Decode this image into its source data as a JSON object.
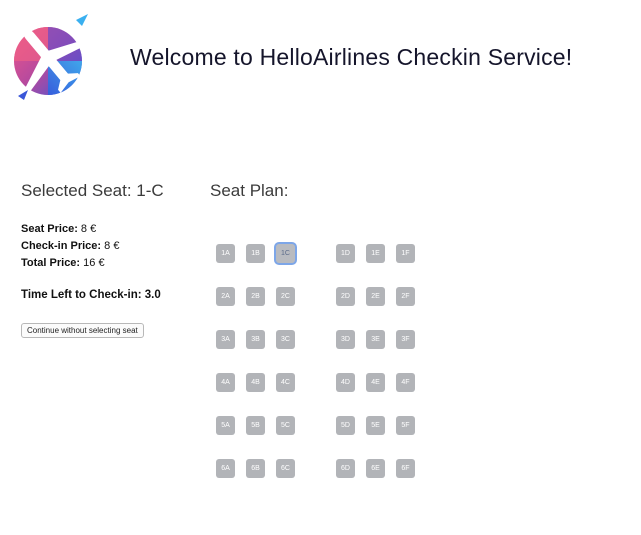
{
  "header": {
    "welcome_text": "Welcome to HelloAirlines Checkin Service!"
  },
  "selection": {
    "selected_seat_label": "Selected Seat: 1-C",
    "seat_price_label": "Seat Price:",
    "seat_price_value": " 8 €",
    "checkin_price_label": "Check-in Price:",
    "checkin_price_value": " 8 €",
    "total_price_label": "Total Price:",
    "total_price_value": " 16 €",
    "time_left_text": "Time Left to Check-in: 3.0",
    "continue_button_label": "Continue without selecting seat"
  },
  "seat_plan": {
    "title": "Seat Plan:",
    "selected_seat": "1C",
    "rows": [
      [
        "1A",
        "1B",
        "1C",
        "1D",
        "1E",
        "1F"
      ],
      [
        "2A",
        "2B",
        "2C",
        "2D",
        "2E",
        "2F"
      ],
      [
        "3A",
        "3B",
        "3C",
        "3D",
        "3E",
        "3F"
      ],
      [
        "4A",
        "4B",
        "4C",
        "4D",
        "4E",
        "4F"
      ],
      [
        "5A",
        "5B",
        "5C",
        "5D",
        "5E",
        "5F"
      ],
      [
        "6A",
        "6B",
        "6C",
        "6D",
        "6E",
        "6F"
      ]
    ]
  },
  "colors": {
    "seat_available": "#b2b4b8",
    "seat_selected_outline": "#7da6e8"
  },
  "icons": {
    "logo": "airplane-logo-icon"
  }
}
